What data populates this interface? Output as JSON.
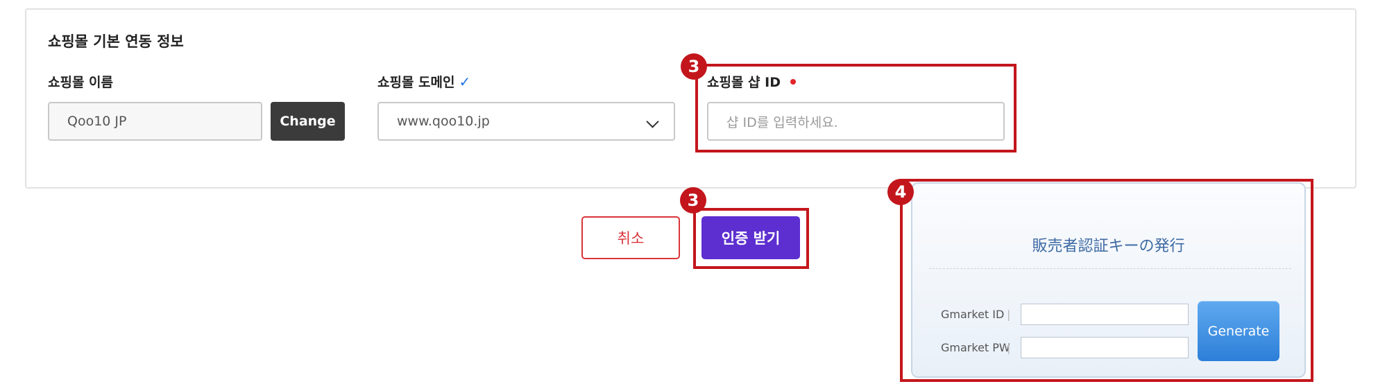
{
  "section": {
    "title": "쇼핑몰 기본 연동 정보"
  },
  "fields": {
    "mall_name": {
      "label": "쇼핑몰 이름",
      "value": "Qoo10 JP",
      "change_label": "Change"
    },
    "mall_domain": {
      "label": "쇼핑몰 도메인",
      "check_icon": "✓",
      "selected": "www.qoo10.jp"
    },
    "shop_id": {
      "label": "쇼핑몰 샵 ID",
      "placeholder": "샵 ID를 입력하세요.",
      "required": true
    }
  },
  "actions": {
    "cancel_label": "취소",
    "auth_label": "인증 받기"
  },
  "badges": {
    "step3": "3",
    "step4": "4"
  },
  "seller_key": {
    "title": "販売者認証キーの発行",
    "id_label": "Gmarket ID",
    "pw_label": "Gmarket PW",
    "separator": "|",
    "generate_label": "Generate"
  },
  "colors": {
    "highlight": "#c3161c",
    "primary": "#5d2fd0",
    "danger": "#d9343a",
    "check": "#1a73e8",
    "generate": "#2c7fd9"
  }
}
